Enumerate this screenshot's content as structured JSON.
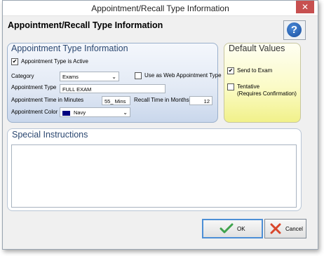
{
  "window": {
    "title": "Appointment/Recall Type Information",
    "close_glyph": "✕"
  },
  "header": {
    "heading": "Appointment/Recall Type Information",
    "help_glyph": "?"
  },
  "appointment_panel": {
    "title": "Appointment Type Information",
    "active_checkbox": {
      "label": "Appointment Type is Active",
      "checked": true
    },
    "category": {
      "label": "Category",
      "value": "Exams"
    },
    "web_checkbox": {
      "label": "Use as Web Appointment Type",
      "checked": false
    },
    "appointment_type": {
      "label": "Appointment Type",
      "value": "FULL EXAM"
    },
    "time_minutes": {
      "label": "Appointment Time in Minutes",
      "value": "55_ Mins"
    },
    "recall_months": {
      "label": "Recall Time in Months",
      "value": "12"
    },
    "color": {
      "label": "Appointment Color",
      "value": "Navy",
      "swatch": "#000080"
    }
  },
  "default_values": {
    "title": "Default Values",
    "send_to_exam": {
      "label": "Send to Exam",
      "checked": true
    },
    "tentative": {
      "label_line1": "Tentative",
      "label_line2": "(Requires Confirmation)",
      "checked": false
    }
  },
  "special_instructions": {
    "title": "Special Instructions",
    "value": ""
  },
  "buttons": {
    "ok_label": "OK",
    "cancel_label": "Cancel"
  },
  "colors": {
    "ok_check": "#3fa34d",
    "cancel_x": "#d9462b"
  }
}
